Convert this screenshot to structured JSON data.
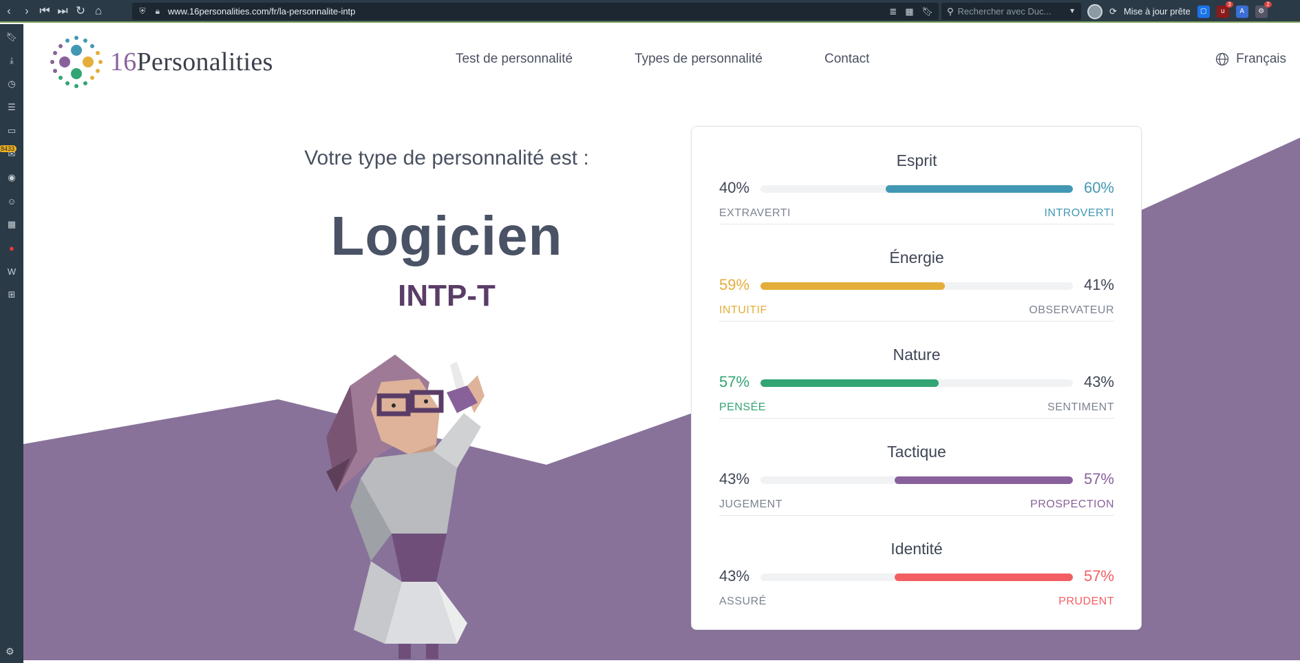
{
  "browser": {
    "url": "www.16personalities.com/fr/la-personnalite-intp",
    "search_placeholder": "Rechercher avec Duc...",
    "update_label": "Mise à jour prête",
    "sidebar_badge": "8433",
    "ext_badge_1": "3",
    "ext_badge_2": "2"
  },
  "site": {
    "logo_number": "16",
    "logo_word": "Personalities",
    "nav": [
      "Test de personnalité",
      "Types de personnalité",
      "Contact"
    ],
    "language": "Français"
  },
  "hero": {
    "subtitle": "Votre type de personnalité est :",
    "type_name": "Logicien",
    "type_code": "INTP-T"
  },
  "traits": [
    {
      "title": "Esprit",
      "left_pct_label": "40%",
      "right_pct_label": "60%",
      "left_label": "EXTRAVERTI",
      "right_label": "INTROVERTI",
      "dominant": "right",
      "value": 60,
      "color": "#4298b4"
    },
    {
      "title": "Énergie",
      "left_pct_label": "59%",
      "right_pct_label": "41%",
      "left_label": "INTUITIF",
      "right_label": "OBSERVATEUR",
      "dominant": "left",
      "value": 59,
      "color": "#e4ae3a"
    },
    {
      "title": "Nature",
      "left_pct_label": "57%",
      "right_pct_label": "43%",
      "left_label": "PENSÉE",
      "right_label": "SENTIMENT",
      "dominant": "left",
      "value": 57,
      "color": "#33a474"
    },
    {
      "title": "Tactique",
      "left_pct_label": "43%",
      "right_pct_label": "57%",
      "left_label": "JUGEMENT",
      "right_label": "PROSPECTION",
      "dominant": "right",
      "value": 57,
      "color": "#88619a"
    },
    {
      "title": "Identité",
      "left_pct_label": "43%",
      "right_pct_label": "57%",
      "left_label": "ASSURÉ",
      "right_label": "PRUDENT",
      "dominant": "right",
      "value": 57,
      "color": "#f25e62"
    }
  ],
  "colors": {
    "bg_purple": "#88729a",
    "text_dark": "#4a5265",
    "code_purple": "#5a3d67"
  }
}
